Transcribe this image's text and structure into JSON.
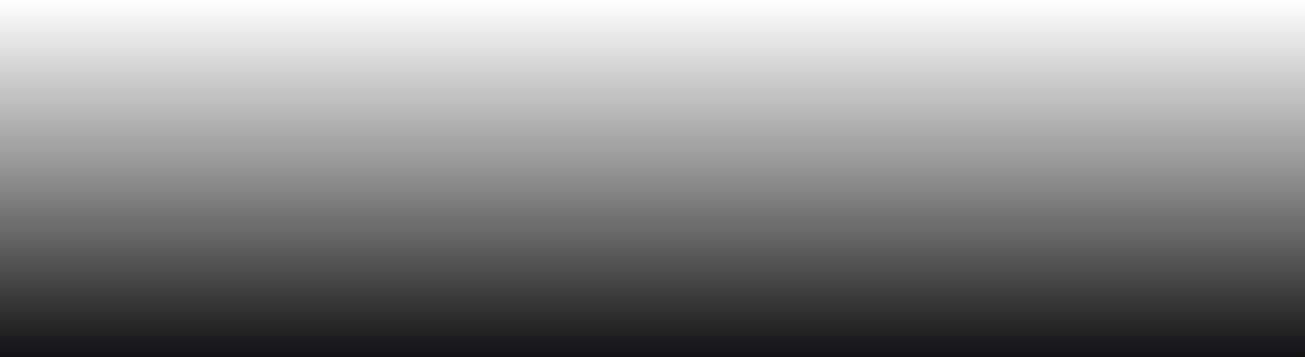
{
  "background": {
    "type": "vertical-gradient",
    "colors": {
      "top": "#ffffff",
      "middle": "#8e8e90",
      "bottom": "#111114"
    }
  }
}
